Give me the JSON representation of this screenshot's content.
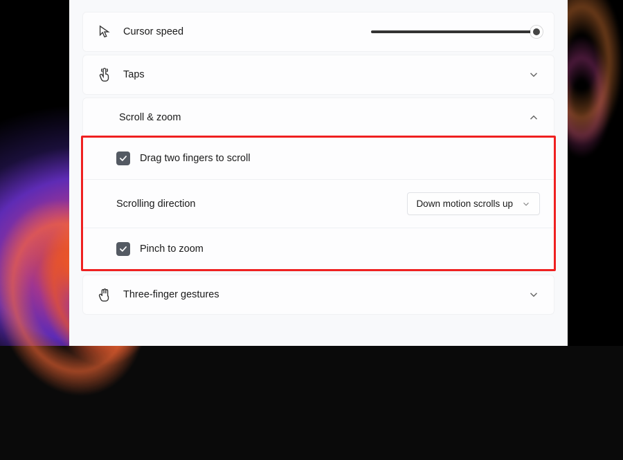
{
  "sections": {
    "cursorSpeed": {
      "label": "Cursor speed",
      "iconName": "cursor-icon",
      "sliderValue": 100
    },
    "taps": {
      "label": "Taps",
      "iconName": "tap-icon",
      "expanded": false
    },
    "scrollZoom": {
      "label": "Scroll & zoom",
      "expanded": true,
      "items": {
        "dragTwoFingers": {
          "label": "Drag two fingers to scroll",
          "checked": true
        },
        "scrollingDirection": {
          "label": "Scrolling direction",
          "selected": "Down motion scrolls up"
        },
        "pinchZoom": {
          "label": "Pinch to zoom",
          "checked": true
        }
      }
    },
    "threeFinger": {
      "label": "Three-finger gestures",
      "iconName": "three-finger-icon",
      "expanded": false
    }
  },
  "highlightBox": {
    "color": "#ef2020",
    "target": "scroll-zoom-expanded-content"
  }
}
